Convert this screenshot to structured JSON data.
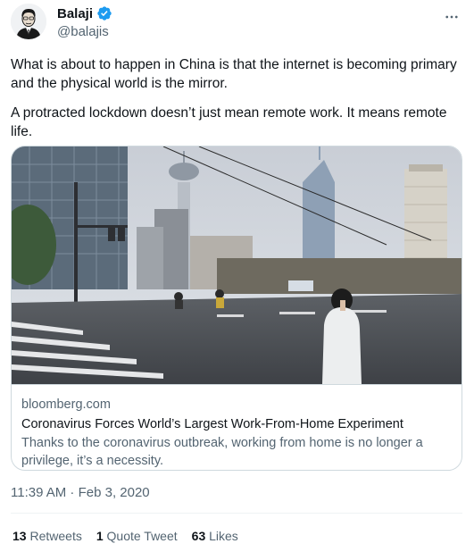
{
  "author": {
    "name": "Balaji",
    "handle": "@balajis"
  },
  "tweet": {
    "paragraph1": "What is about to happen in China is that the internet is becoming primary and the physical world is the mirror.",
    "paragraph2": "A protracted lockdown doesn’t just mean remote work. It means remote life."
  },
  "card": {
    "domain": "bloomberg.com",
    "title": "Coronavirus Forces World’s Largest Work-From-Home Experiment",
    "description": "Thanks to the coronavirus outbreak, working from home is no longer a privilege, it’s a necessity."
  },
  "timestamp": "11:39 AM · Feb 3, 2020",
  "stats": {
    "retweets_count": "13",
    "retweets_label": "Retweets",
    "quotes_count": "1",
    "quotes_label": "Quote Tweet",
    "likes_count": "63",
    "likes_label": "Likes"
  },
  "icons": {
    "verified": "verified-badge-icon",
    "more": "more-options-icon"
  },
  "colors": {
    "verified_blue": "#1d9bf0",
    "secondary_text": "#536471",
    "border": "#cfd9de"
  }
}
